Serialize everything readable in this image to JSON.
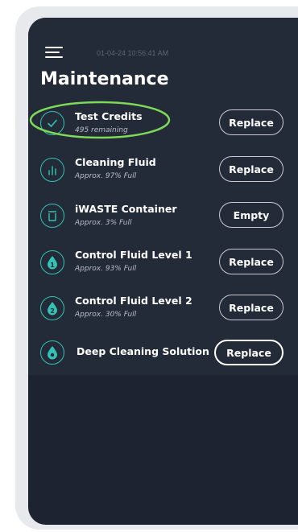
{
  "header": {
    "datetime": "01-04-24 10:56:41 AM",
    "title": "Maintenance"
  },
  "items": [
    {
      "name": "Test Credits",
      "sub": "495 remaining",
      "button": "Replace",
      "icon": "check-icon"
    },
    {
      "name": "Cleaning Fluid",
      "sub": "Approx. 97% Full",
      "button": "Replace",
      "icon": "fluid-level-icon"
    },
    {
      "name": "iWASTE Container",
      "sub": "Approx. 3% Full",
      "button": "Empty",
      "icon": "trash-icon"
    },
    {
      "name": "Control Fluid Level 1",
      "sub": "Approx. 93% Full",
      "button": "Replace",
      "icon": "drop-1-icon"
    },
    {
      "name": "Control Fluid Level 2",
      "sub": "Approx. 30% Full",
      "button": "Replace",
      "icon": "drop-2-icon"
    },
    {
      "name": "Deep Cleaning Solution",
      "sub": "",
      "button": "Replace",
      "icon": "drop-lock-icon"
    }
  ],
  "colors": {
    "accent": "#34c3b3",
    "highlight": "#7ed957",
    "background": "#232a38"
  }
}
